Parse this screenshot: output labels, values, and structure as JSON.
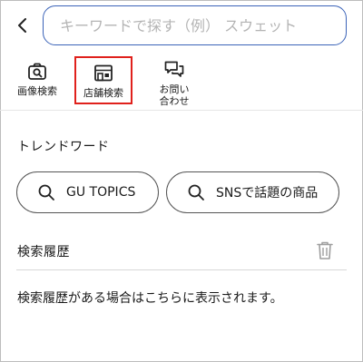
{
  "header": {
    "search_placeholder": "キーワードで探す（例） スウェット"
  },
  "actions": {
    "image_search": "画像検索",
    "store_search": "店舗検索",
    "contact": "お問い合わせ"
  },
  "trending": {
    "title": "トレンドワード",
    "chips": [
      {
        "label": "GU TOPICS"
      },
      {
        "label": "SNSで話題の商品"
      }
    ]
  },
  "history": {
    "title": "検索履歴",
    "empty_message": "検索履歴がある場合はこちらに表示されます。"
  },
  "colors": {
    "accent_border": "#3b63b8",
    "highlight": "#e0211c"
  },
  "icons": {
    "back": "chevron-left-icon",
    "image_search": "camera-search-icon",
    "store_search": "store-icon",
    "contact": "chat-bubbles-icon",
    "search": "search-icon",
    "delete": "trash-icon"
  }
}
